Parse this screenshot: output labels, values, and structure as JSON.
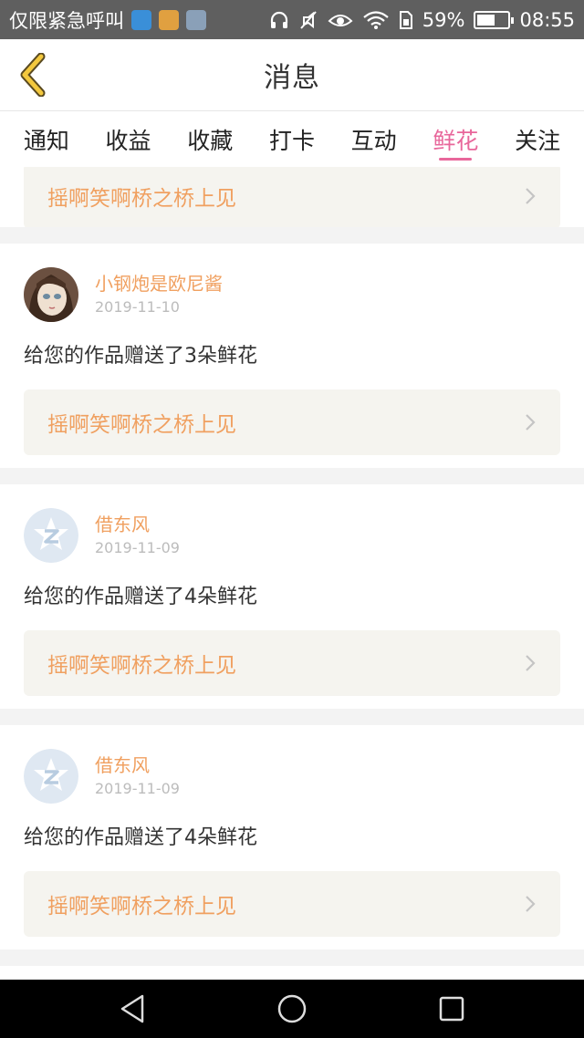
{
  "status_bar": {
    "carrier_text": "仅限紧急呼叫",
    "battery_percent": "59%",
    "battery_level": 0.59,
    "time": "08:55",
    "icons": [
      "notification-app-icon",
      "lock-app-icon",
      "gallery-app-icon",
      "headphone-icon",
      "mute-icon",
      "eye-icon",
      "wifi-icon",
      "sim-icon",
      "battery-icon"
    ]
  },
  "header": {
    "title": "消息",
    "back_icon": "chevron-left-icon"
  },
  "tabs": [
    {
      "label": "通知",
      "active": false
    },
    {
      "label": "收益",
      "active": false
    },
    {
      "label": "收藏",
      "active": false
    },
    {
      "label": "打卡",
      "active": false
    },
    {
      "label": "互动",
      "active": false
    },
    {
      "label": "鲜花",
      "active": true
    },
    {
      "label": "关注",
      "active": false
    }
  ],
  "partial_card": {
    "work_title": "摇啊笑啊桥之桥上见"
  },
  "messages": [
    {
      "user_name": "小钢炮是欧尼酱",
      "date": "2019-11-10",
      "text": "给您的作品赠送了3朵鲜花",
      "work_title": "摇啊笑啊桥之桥上见",
      "avatar": "doll-avatar"
    },
    {
      "user_name": "借东风",
      "date": "2019-11-09",
      "text": "给您的作品赠送了4朵鲜花",
      "work_title": "摇啊笑啊桥之桥上见",
      "avatar": "default-avatar"
    },
    {
      "user_name": "借东风",
      "date": "2019-11-09",
      "text": "给您的作品赠送了4朵鲜花",
      "work_title": "摇啊笑啊桥之桥上见",
      "avatar": "default-avatar"
    }
  ],
  "colors": {
    "accent_pink": "#e8679b",
    "name_orange": "#f0a060",
    "back_arrow_yellow": "#f3c83e"
  }
}
